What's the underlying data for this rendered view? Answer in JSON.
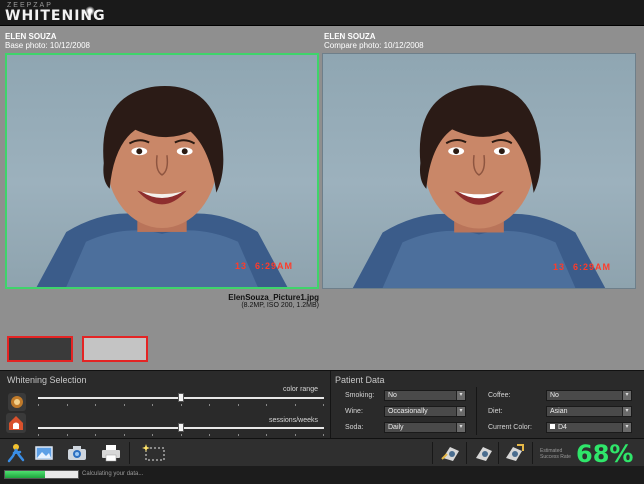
{
  "app": {
    "brand_small": "ZEEPZAP",
    "brand_big": "WHITENING"
  },
  "photos": {
    "base": {
      "patient": "ELEN SOUZA",
      "caption": "Base photo: 10/12/2008",
      "stamp_day": "13",
      "stamp_time": "6:29AM"
    },
    "compare": {
      "patient": "ELEN SOUZA",
      "caption": "Compare photo: 10/12/2008",
      "stamp_day": "13",
      "stamp_time": "6:29AM"
    },
    "file_name": "ElenSouza_Picture1.jpg",
    "file_info": "(8.2MP, ISO 200, 1.2MB)"
  },
  "whitening_selection": {
    "title": "Whitening Selection",
    "sliders": [
      {
        "label": "color range",
        "value": 0.5
      },
      {
        "label": "sessions/weeks",
        "value": 0.5
      }
    ]
  },
  "patient_data": {
    "title": "Patient Data",
    "fields": {
      "smoking": {
        "label": "Smoking:",
        "value": "No"
      },
      "wine": {
        "label": "Wine:",
        "value": "Occasionally"
      },
      "soda": {
        "label": "Soda:",
        "value": "Daily"
      },
      "coffee": {
        "label": "Coffee:",
        "value": "No"
      },
      "diet": {
        "label": "Diet:",
        "value": "Asian"
      },
      "current_color": {
        "label": "Current Color:",
        "value": "D4"
      }
    }
  },
  "success_rate": {
    "label_line1": "Estimated",
    "label_line2": "Success Rate",
    "value": "68%"
  },
  "status": {
    "text": "Calculating your data...",
    "progress": 0.55
  },
  "colors": {
    "accent_green": "#2fe66a",
    "selection_red": "#e42424",
    "photo_frame_green": "#3fd46b",
    "timestamp_red": "#ff3b2a"
  },
  "icons": [
    "radio-icon",
    "tooth-icon",
    "patient-walk-icon",
    "photo-import-icon",
    "camera-import-icon",
    "printer-icon",
    "selection-rect-icon",
    "camera-tool-1-icon",
    "camera-tool-2-icon",
    "camera-tool-3-icon"
  ]
}
